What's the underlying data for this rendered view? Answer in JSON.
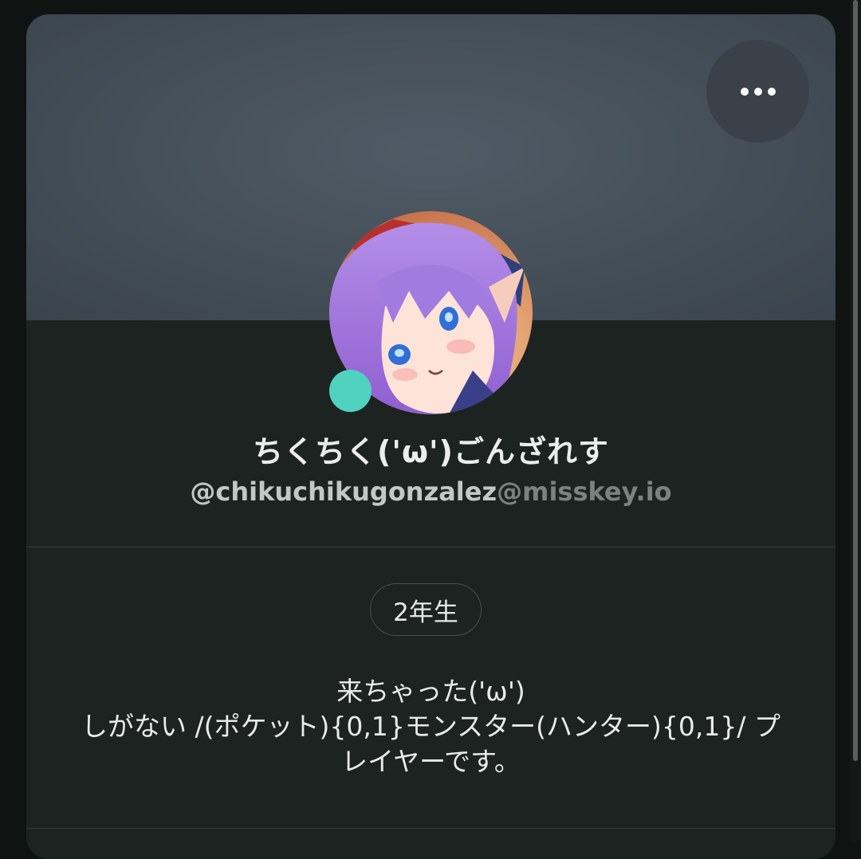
{
  "profile": {
    "display_name": "ちくちく('ω')ごんざれす",
    "username": "@chikuchikugonzalez",
    "host": "@misskey.io",
    "badge": "2年生",
    "bio_lines": [
      "来ちゃった('ω')",
      "しがない /(ポケット){0,1}モンスター(ハンター){0,1}/ プ",
      "レイヤーです。"
    ],
    "online_status_color": "#4fd3c0"
  },
  "icons": {
    "menu": "more-horizontal-icon",
    "avatar": "anime-avatar-image"
  },
  "colors": {
    "card_bg": "#1d2321",
    "banner": "#46515b",
    "accent_status": "#4fd3c0"
  }
}
